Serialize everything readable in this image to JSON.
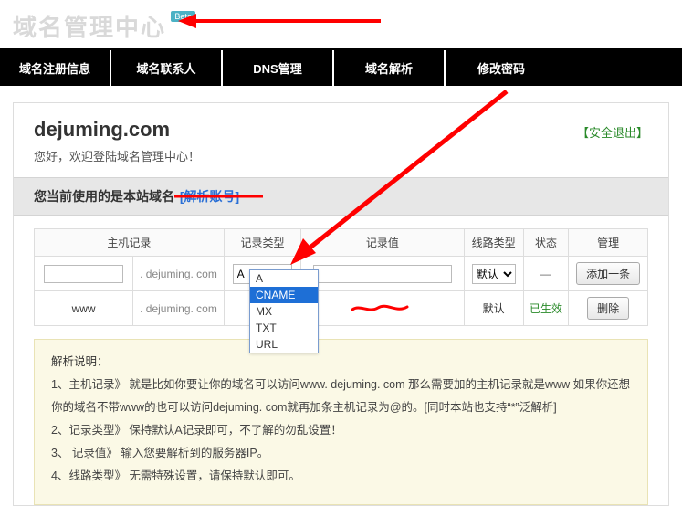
{
  "brand": {
    "title": "域名管理中心",
    "badge": "Beta"
  },
  "nav": {
    "items": [
      "域名注册信息",
      "域名联系人",
      "DNS管理",
      "域名解析",
      "修改密码"
    ]
  },
  "header": {
    "domain": "dejuming.com",
    "welcome": "您好，欢迎登陆域名管理中心！",
    "logout": "【安全退出】"
  },
  "notice": {
    "prefix": "您当前使用的是本站域名",
    "account": "[解析账号]"
  },
  "table": {
    "headers": {
      "host": "主机记录",
      "type": "记录类型",
      "value": "记录值",
      "line": "线路类型",
      "status": "状态",
      "action": "管理"
    },
    "suffix": ". dejuming. com",
    "type_options": [
      "A",
      "CNAME",
      "MX",
      "TXT",
      "URL"
    ],
    "line_options": [
      "默认"
    ],
    "new_row": {
      "host": "",
      "type": "A",
      "value": "",
      "line": "默认",
      "status": "—",
      "action": "添加一条"
    },
    "rows": [
      {
        "host": "www",
        "type": "A",
        "value": "",
        "line": "默认",
        "status": "已生效",
        "action": "删除"
      }
    ]
  },
  "help": {
    "title": "解析说明：",
    "lines": [
      "1、主机记录》 就是比如你要让你的域名可以访问www. dejuming. com 那么需要加的主机记录就是www 如果你还想你的域名不带www的也可以访问dejuming. com就再加条主机记录为@的。[同时本站也支持“*”泛解析]",
      "2、记录类型》 保持默认A记录即可，不了解的勿乱设置！",
      "3、 记录值》 输入您要解析到的服务器IP。",
      "4、线路类型》 无需特殊设置，请保持默认即可。"
    ]
  }
}
